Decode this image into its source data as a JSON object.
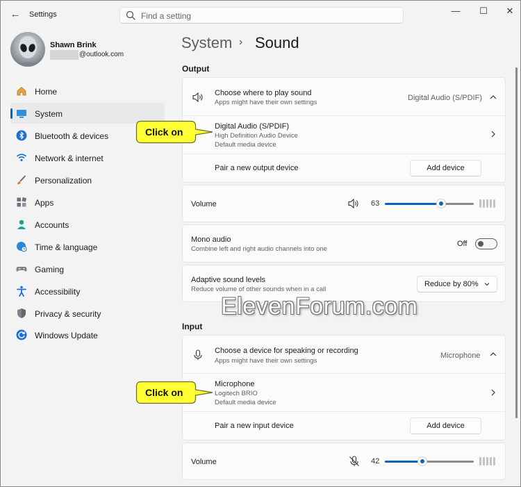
{
  "window": {
    "title": "Settings",
    "controls": {
      "minimize": "—",
      "maximize": "☐",
      "close": "✕"
    }
  },
  "search": {
    "placeholder": "Find a setting"
  },
  "profile": {
    "name": "Shawn Brink",
    "email_suffix": "@outlook.com"
  },
  "sidebar": {
    "items": [
      {
        "label": "Home",
        "icon": "home-icon"
      },
      {
        "label": "System",
        "icon": "monitor-icon",
        "active": true
      },
      {
        "label": "Bluetooth & devices",
        "icon": "bluetooth-icon"
      },
      {
        "label": "Network & internet",
        "icon": "wifi-icon"
      },
      {
        "label": "Personalization",
        "icon": "brush-icon"
      },
      {
        "label": "Apps",
        "icon": "apps-icon"
      },
      {
        "label": "Accounts",
        "icon": "person-icon"
      },
      {
        "label": "Time & language",
        "icon": "globe-clock-icon"
      },
      {
        "label": "Gaming",
        "icon": "gamepad-icon"
      },
      {
        "label": "Accessibility",
        "icon": "accessibility-icon"
      },
      {
        "label": "Privacy & security",
        "icon": "shield-icon"
      },
      {
        "label": "Windows Update",
        "icon": "update-icon"
      }
    ]
  },
  "breadcrumb": {
    "parent": "System",
    "separator": "›",
    "current": "Sound"
  },
  "output": {
    "section_title": "Output",
    "choose": {
      "title": "Choose where to play sound",
      "subtitle": "Apps might have their own settings",
      "value": "Digital Audio (S/PDIF)"
    },
    "device": {
      "name": "Digital Audio (S/PDIF)",
      "line1": "High Definition Audio Device",
      "line2": "Default media device"
    },
    "pair": {
      "label": "Pair a new output device",
      "button": "Add device"
    },
    "volume": {
      "label": "Volume",
      "value": "63",
      "level": 63
    },
    "mono": {
      "title": "Mono audio",
      "subtitle": "Combine left and right audio channels into one",
      "state": "Off"
    },
    "adaptive": {
      "title": "Adaptive sound levels",
      "subtitle": "Reduce volume of other sounds when in a call",
      "selected": "Reduce by 80%"
    }
  },
  "input": {
    "section_title": "Input",
    "choose": {
      "title": "Choose a device for speaking or recording",
      "subtitle": "Apps might have their own settings",
      "value": "Microphone"
    },
    "device": {
      "name": "Microphone",
      "line1": "Logitech BRIO",
      "line2": "Default media device"
    },
    "pair": {
      "label": "Pair a new input device",
      "button": "Add device"
    },
    "volume": {
      "label": "Volume",
      "value": "42",
      "level": 42
    }
  },
  "callouts": {
    "output_device": "Click on",
    "input_device": "Click on"
  },
  "watermark": "ElevenForum.com",
  "colors": {
    "accent": "#0067c0",
    "callout_fill": "#ffff33",
    "window_bg": "#f3f3f3",
    "card_bg": "#fbfbfb"
  }
}
